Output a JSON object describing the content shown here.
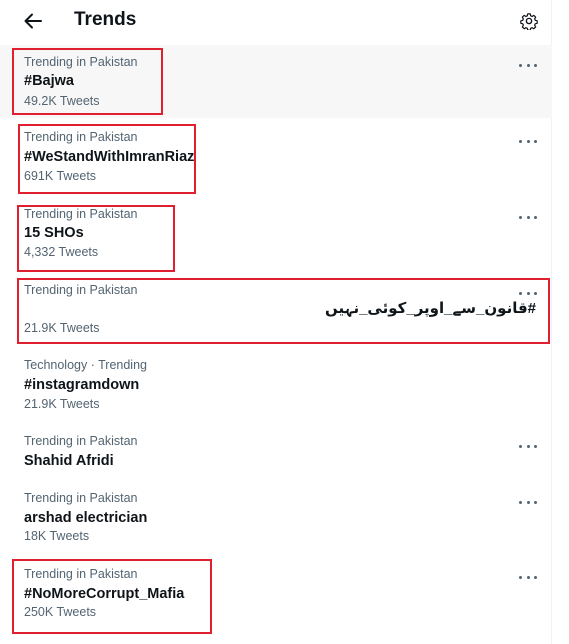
{
  "header": {
    "title": "Trends",
    "back_icon": "arrow-left-icon",
    "settings_icon": "gear-icon"
  },
  "trends": [
    {
      "meta": "Trending in Pakistan",
      "name": "#Bajwa",
      "count": "49.2K Tweets",
      "highlighted": true
    },
    {
      "meta": "Trending in Pakistan",
      "name": "#WeStandWithImranRiaz",
      "count": "691K Tweets",
      "highlighted": true
    },
    {
      "meta": "Trending in Pakistan",
      "name": "15 SHOs",
      "count": "4,332 Tweets",
      "highlighted": true
    },
    {
      "meta": "Trending in Pakistan",
      "name": "#قانون_سے_اوپر_کوئی_نہیں",
      "count": "21.9K Tweets",
      "highlighted": true
    },
    {
      "meta": "Technology · Trending",
      "name": "#instagramdown",
      "count": "21.9K Tweets",
      "highlighted": false
    },
    {
      "meta": "Trending in Pakistan",
      "name": "Shahid Afridi",
      "count": "",
      "highlighted": false
    },
    {
      "meta": "Trending in Pakistan",
      "name": "arshad electrician",
      "count": "18K Tweets",
      "highlighted": false
    },
    {
      "meta": "Trending in Pakistan",
      "name": "#NoMoreCorrupt_Mafia",
      "count": "250K Tweets",
      "highlighted": true
    }
  ],
  "colors": {
    "highlight_box": "#e0202e",
    "secondary_text": "#536471",
    "primary_text": "#0f1419",
    "hover_background": "#f7f7f7"
  },
  "more_icon": "more-horizontal-icon"
}
